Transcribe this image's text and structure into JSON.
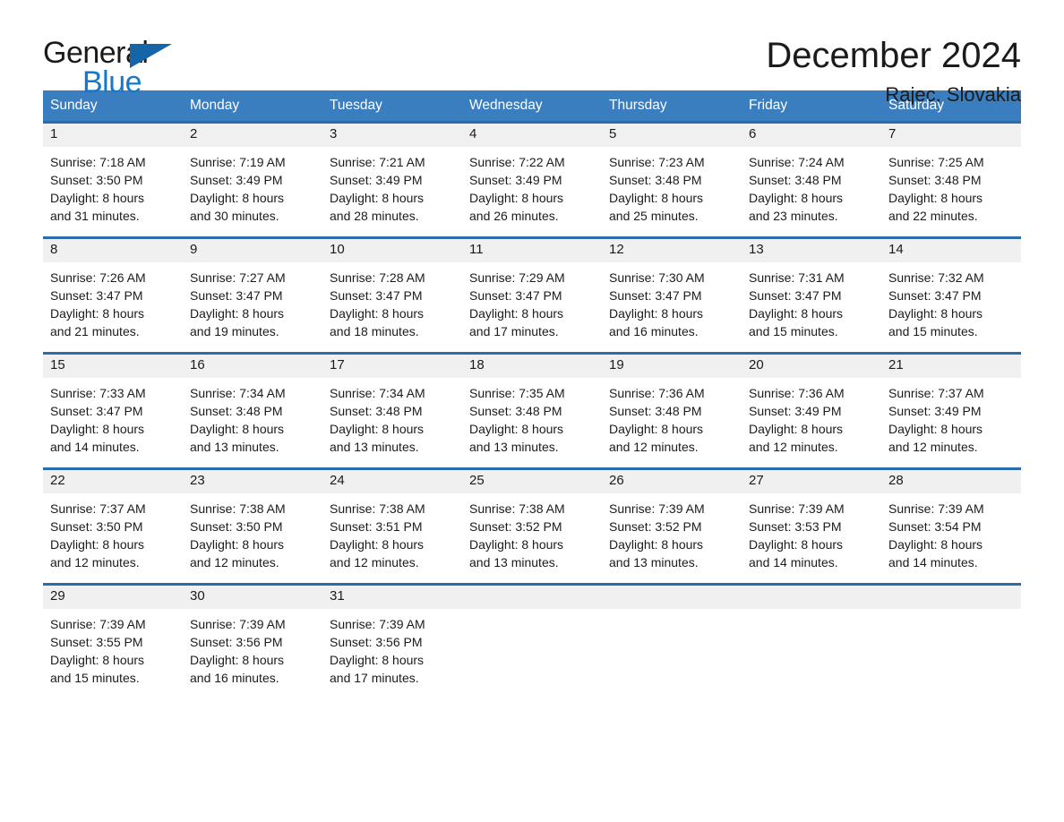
{
  "brand": {
    "name_part1": "General",
    "name_part2": "Blue",
    "triangle_color": "#1565a8",
    "blue_color": "#1678c8"
  },
  "header": {
    "title": "December 2024",
    "subtitle": "Rajec, Slovakia",
    "header_bg": "#3a7ebf",
    "separator_color": "#2b6cac",
    "daynum_band_bg": "#f0f0f0"
  },
  "weekdays": [
    "Sunday",
    "Monday",
    "Tuesday",
    "Wednesday",
    "Thursday",
    "Friday",
    "Saturday"
  ],
  "weeks": [
    {
      "days": [
        {
          "num": "1",
          "lines": [
            "Sunrise: 7:18 AM",
            "Sunset: 3:50 PM",
            "Daylight: 8 hours",
            "and 31 minutes."
          ]
        },
        {
          "num": "2",
          "lines": [
            "Sunrise: 7:19 AM",
            "Sunset: 3:49 PM",
            "Daylight: 8 hours",
            "and 30 minutes."
          ]
        },
        {
          "num": "3",
          "lines": [
            "Sunrise: 7:21 AM",
            "Sunset: 3:49 PM",
            "Daylight: 8 hours",
            "and 28 minutes."
          ]
        },
        {
          "num": "4",
          "lines": [
            "Sunrise: 7:22 AM",
            "Sunset: 3:49 PM",
            "Daylight: 8 hours",
            "and 26 minutes."
          ]
        },
        {
          "num": "5",
          "lines": [
            "Sunrise: 7:23 AM",
            "Sunset: 3:48 PM",
            "Daylight: 8 hours",
            "and 25 minutes."
          ]
        },
        {
          "num": "6",
          "lines": [
            "Sunrise: 7:24 AM",
            "Sunset: 3:48 PM",
            "Daylight: 8 hours",
            "and 23 minutes."
          ]
        },
        {
          "num": "7",
          "lines": [
            "Sunrise: 7:25 AM",
            "Sunset: 3:48 PM",
            "Daylight: 8 hours",
            "and 22 minutes."
          ]
        }
      ]
    },
    {
      "days": [
        {
          "num": "8",
          "lines": [
            "Sunrise: 7:26 AM",
            "Sunset: 3:47 PM",
            "Daylight: 8 hours",
            "and 21 minutes."
          ]
        },
        {
          "num": "9",
          "lines": [
            "Sunrise: 7:27 AM",
            "Sunset: 3:47 PM",
            "Daylight: 8 hours",
            "and 19 minutes."
          ]
        },
        {
          "num": "10",
          "lines": [
            "Sunrise: 7:28 AM",
            "Sunset: 3:47 PM",
            "Daylight: 8 hours",
            "and 18 minutes."
          ]
        },
        {
          "num": "11",
          "lines": [
            "Sunrise: 7:29 AM",
            "Sunset: 3:47 PM",
            "Daylight: 8 hours",
            "and 17 minutes."
          ]
        },
        {
          "num": "12",
          "lines": [
            "Sunrise: 7:30 AM",
            "Sunset: 3:47 PM",
            "Daylight: 8 hours",
            "and 16 minutes."
          ]
        },
        {
          "num": "13",
          "lines": [
            "Sunrise: 7:31 AM",
            "Sunset: 3:47 PM",
            "Daylight: 8 hours",
            "and 15 minutes."
          ]
        },
        {
          "num": "14",
          "lines": [
            "Sunrise: 7:32 AM",
            "Sunset: 3:47 PM",
            "Daylight: 8 hours",
            "and 15 minutes."
          ]
        }
      ]
    },
    {
      "days": [
        {
          "num": "15",
          "lines": [
            "Sunrise: 7:33 AM",
            "Sunset: 3:47 PM",
            "Daylight: 8 hours",
            "and 14 minutes."
          ]
        },
        {
          "num": "16",
          "lines": [
            "Sunrise: 7:34 AM",
            "Sunset: 3:48 PM",
            "Daylight: 8 hours",
            "and 13 minutes."
          ]
        },
        {
          "num": "17",
          "lines": [
            "Sunrise: 7:34 AM",
            "Sunset: 3:48 PM",
            "Daylight: 8 hours",
            "and 13 minutes."
          ]
        },
        {
          "num": "18",
          "lines": [
            "Sunrise: 7:35 AM",
            "Sunset: 3:48 PM",
            "Daylight: 8 hours",
            "and 13 minutes."
          ]
        },
        {
          "num": "19",
          "lines": [
            "Sunrise: 7:36 AM",
            "Sunset: 3:48 PM",
            "Daylight: 8 hours",
            "and 12 minutes."
          ]
        },
        {
          "num": "20",
          "lines": [
            "Sunrise: 7:36 AM",
            "Sunset: 3:49 PM",
            "Daylight: 8 hours",
            "and 12 minutes."
          ]
        },
        {
          "num": "21",
          "lines": [
            "Sunrise: 7:37 AM",
            "Sunset: 3:49 PM",
            "Daylight: 8 hours",
            "and 12 minutes."
          ]
        }
      ]
    },
    {
      "days": [
        {
          "num": "22",
          "lines": [
            "Sunrise: 7:37 AM",
            "Sunset: 3:50 PM",
            "Daylight: 8 hours",
            "and 12 minutes."
          ]
        },
        {
          "num": "23",
          "lines": [
            "Sunrise: 7:38 AM",
            "Sunset: 3:50 PM",
            "Daylight: 8 hours",
            "and 12 minutes."
          ]
        },
        {
          "num": "24",
          "lines": [
            "Sunrise: 7:38 AM",
            "Sunset: 3:51 PM",
            "Daylight: 8 hours",
            "and 12 minutes."
          ]
        },
        {
          "num": "25",
          "lines": [
            "Sunrise: 7:38 AM",
            "Sunset: 3:52 PM",
            "Daylight: 8 hours",
            "and 13 minutes."
          ]
        },
        {
          "num": "26",
          "lines": [
            "Sunrise: 7:39 AM",
            "Sunset: 3:52 PM",
            "Daylight: 8 hours",
            "and 13 minutes."
          ]
        },
        {
          "num": "27",
          "lines": [
            "Sunrise: 7:39 AM",
            "Sunset: 3:53 PM",
            "Daylight: 8 hours",
            "and 14 minutes."
          ]
        },
        {
          "num": "28",
          "lines": [
            "Sunrise: 7:39 AM",
            "Sunset: 3:54 PM",
            "Daylight: 8 hours",
            "and 14 minutes."
          ]
        }
      ]
    },
    {
      "days": [
        {
          "num": "29",
          "lines": [
            "Sunrise: 7:39 AM",
            "Sunset: 3:55 PM",
            "Daylight: 8 hours",
            "and 15 minutes."
          ]
        },
        {
          "num": "30",
          "lines": [
            "Sunrise: 7:39 AM",
            "Sunset: 3:56 PM",
            "Daylight: 8 hours",
            "and 16 minutes."
          ]
        },
        {
          "num": "31",
          "lines": [
            "Sunrise: 7:39 AM",
            "Sunset: 3:56 PM",
            "Daylight: 8 hours",
            "and 17 minutes."
          ]
        },
        {
          "num": "",
          "lines": []
        },
        {
          "num": "",
          "lines": []
        },
        {
          "num": "",
          "lines": []
        },
        {
          "num": "",
          "lines": []
        }
      ]
    }
  ]
}
